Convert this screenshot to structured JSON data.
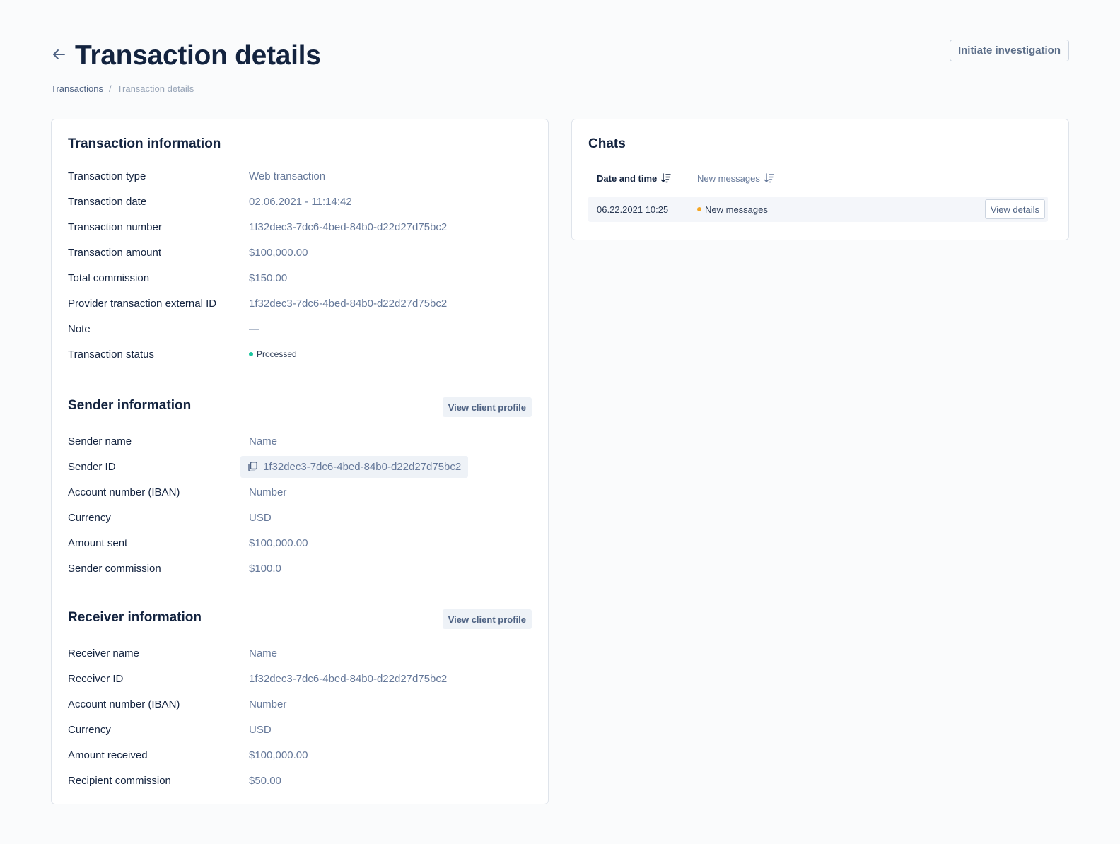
{
  "header": {
    "title": "Transaction details",
    "initiate_label": "Initiate investigation"
  },
  "breadcrumb": {
    "parent": "Transactions",
    "separator": "/",
    "current": "Transaction details"
  },
  "transaction_info": {
    "title": "Transaction information",
    "rows": [
      {
        "label": "Transaction type",
        "value": "Web transaction"
      },
      {
        "label": "Transaction date",
        "value": "02.06.2021 - 11:14:42"
      },
      {
        "label": "Transaction number",
        "value": "1f32dec3-7dc6-4bed-84b0-d22d27d75bc2"
      },
      {
        "label": "Transaction amount",
        "value": "$100,000.00"
      },
      {
        "label": "Total commission",
        "value": "$150.00"
      },
      {
        "label": "Provider transaction external ID",
        "value": "1f32dec3-7dc6-4bed-84b0-d22d27d75bc2"
      },
      {
        "label": "Note",
        "value": "—"
      },
      {
        "label": "Transaction status",
        "value": "Processed"
      }
    ],
    "status_color": "#1bc6a0"
  },
  "sender_info": {
    "title": "Sender information",
    "profile_button": "View client profile",
    "rows": [
      {
        "label": "Sender name",
        "value": "Name"
      },
      {
        "label": "Sender ID",
        "value": "1f32dec3-7dc6-4bed-84b0-d22d27d75bc2"
      },
      {
        "label": "Account number (IBAN)",
        "value": "Number"
      },
      {
        "label": "Currency",
        "value": "USD"
      },
      {
        "label": "Amount sent",
        "value": "$100,000.00"
      },
      {
        "label": "Sender commission",
        "value": "$100.0"
      }
    ]
  },
  "receiver_info": {
    "title": "Receiver information",
    "profile_button": "View client profile",
    "rows": [
      {
        "label": "Receiver name",
        "value": "Name"
      },
      {
        "label": "Receiver ID",
        "value": "1f32dec3-7dc6-4bed-84b0-d22d27d75bc2"
      },
      {
        "label": "Account number (IBAN)",
        "value": "Number"
      },
      {
        "label": "Currency",
        "value": "USD"
      },
      {
        "label": "Amount received",
        "value": "$100,000.00"
      },
      {
        "label": "Recipient commission",
        "value": "$50.00"
      }
    ]
  },
  "chats": {
    "title": "Chats",
    "columns": [
      "Date and time",
      "New messages"
    ],
    "rows": [
      {
        "date": "06.22.2021 10:25",
        "status": "New messages",
        "action": "View details"
      }
    ],
    "new_dot_color": "#f5a623"
  },
  "icons": {
    "back": "arrow-left-icon",
    "sort": "sort-icon",
    "copy": "copy-icon"
  }
}
